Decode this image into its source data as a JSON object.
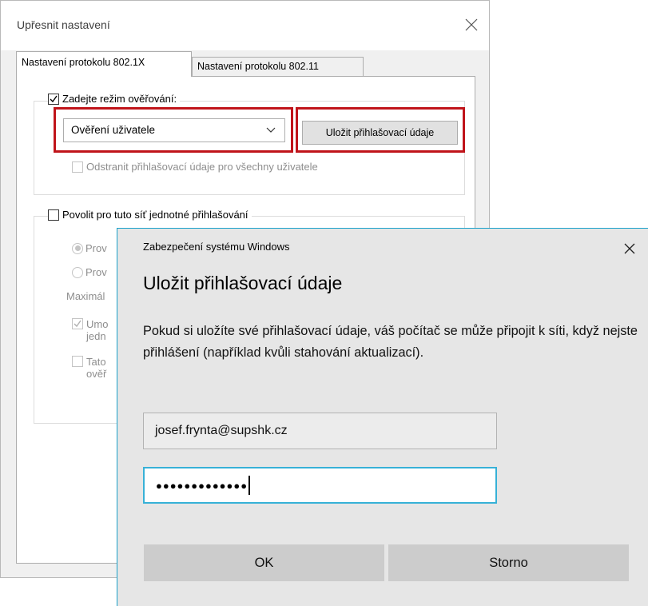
{
  "back_dialog": {
    "title": "Upřesnit nastavení",
    "tabs": [
      {
        "label": "Nastavení protokolu 802.1X"
      },
      {
        "label": "Nastavení protokolu 802.11"
      }
    ],
    "auth_group": {
      "checkbox_label": "Zadejte režim ověřování:",
      "checked": true,
      "mode_value": "Ověření uživatele",
      "save_button": "Uložit přihlašovací údaje",
      "remove_label": "Odstranit přihlašovací údaje pro všechny uživatele"
    },
    "sso_group": {
      "checkbox_label": "Povolit pro tuto síť jednotné přihlašování",
      "radio1": "Prov",
      "radio2": "Prov",
      "max_label": "Maximál",
      "check1_line1": "Umo",
      "check1_line2": "jedn",
      "check2_line1": "Tato",
      "check2_line2": "ověř"
    }
  },
  "front_dialog": {
    "app_name": "Zabezpečení systému Windows",
    "title": "Uložit přihlašovací údaje",
    "body": "Pokud si uložíte své přihlašovací údaje, váš počítač se může připojit k síti, když nejste přihlášení (například kvůli stahování aktualizací).",
    "username": "josef.frynta@supshk.cz",
    "password_mask": "●●●●●●●●●●●●●",
    "ok_label": "OK",
    "cancel_label": "Storno"
  },
  "colors": {
    "highlight": "#c0141a",
    "accent": "#1aa1ca"
  }
}
